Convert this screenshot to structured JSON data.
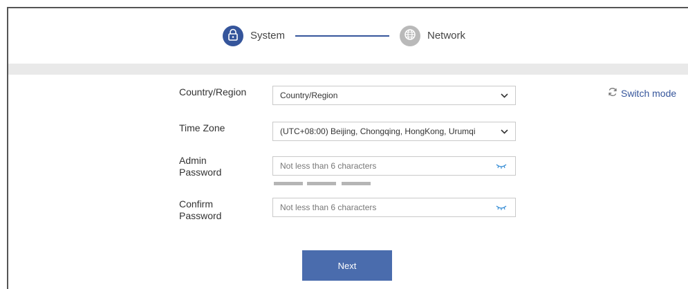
{
  "stepper": {
    "steps": [
      {
        "label": "System",
        "icon": "lock-icon",
        "state": "active"
      },
      {
        "label": "Network",
        "icon": "globe-icon",
        "state": "inactive"
      }
    ]
  },
  "switch_mode": {
    "label": "Switch mode",
    "icon": "refresh-icon"
  },
  "form": {
    "country": {
      "label": "Country/Region",
      "value": "Country/Region"
    },
    "timezone": {
      "label": "Time Zone",
      "value": "(UTC+08:00) Beijing, Chongqing, HongKong, Urumqi"
    },
    "admin_password": {
      "label_line1": "Admin",
      "label_line2": "Password",
      "placeholder": "Not less than 6 characters"
    },
    "confirm_password": {
      "label_line1": "Confirm",
      "label_line2": "Password",
      "placeholder": "Not less than 6 characters"
    }
  },
  "next_label": "Next",
  "colors": {
    "accent": "#35559b",
    "button": "#4a6cad",
    "inactive": "#b9b9b9",
    "band": "#e9e9e9"
  }
}
